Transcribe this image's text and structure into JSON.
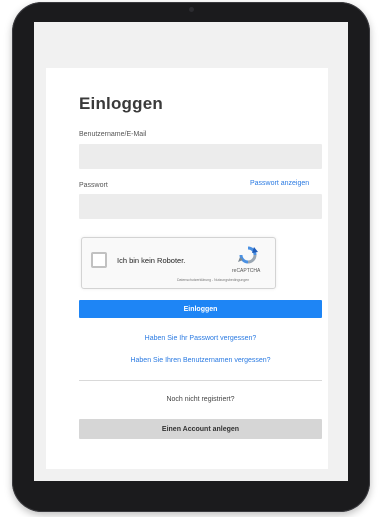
{
  "page": {
    "title": "Einloggen",
    "username_label": "Benutzername/E-Mail",
    "password_label": "Passwort",
    "show_password_link": "Passwort anzeigen",
    "username_value": "",
    "password_value": ""
  },
  "captcha": {
    "checkbox_label": "Ich bin kein Roboter.",
    "brand": "reCAPTCHA",
    "privacy_terms": "Datenschutzerklärung - Nutzungsbedingungen",
    "checked": false
  },
  "actions": {
    "login_button": "Einloggen",
    "forgot_password": "Haben Sie Ihr Passwort vergessen?",
    "forgot_username": "Haben Sie Ihren Benutzernamen vergessen?",
    "not_registered": "Noch nicht registriert?",
    "create_account_button": "Einen Account anlegen"
  },
  "colors": {
    "primary": "#1e85f5",
    "link": "#2a7ae2",
    "device_frame": "#1b1b1d"
  }
}
